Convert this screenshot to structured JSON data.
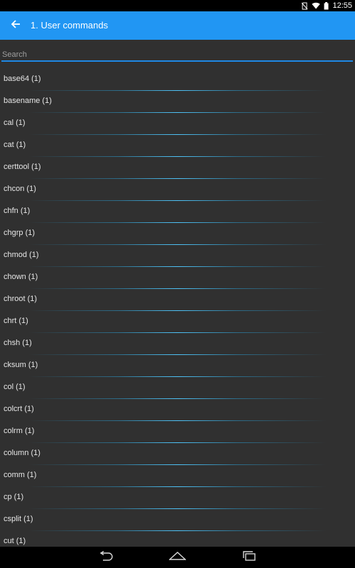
{
  "status_bar": {
    "time": "12:55",
    "icons": [
      "no-sim-icon",
      "wifi-icon",
      "battery-icon"
    ]
  },
  "app_bar": {
    "title": "1. User commands",
    "back_icon": "arrow-back-icon",
    "color": "#2196f3"
  },
  "search": {
    "placeholder": "Search",
    "value": ""
  },
  "commands": [
    {
      "label": "base64 (1)"
    },
    {
      "label": "basename (1)"
    },
    {
      "label": "cal (1)"
    },
    {
      "label": "cat (1)"
    },
    {
      "label": "certtool (1)"
    },
    {
      "label": "chcon (1)"
    },
    {
      "label": "chfn (1)"
    },
    {
      "label": "chgrp (1)"
    },
    {
      "label": "chmod (1)"
    },
    {
      "label": "chown (1)"
    },
    {
      "label": "chroot (1)"
    },
    {
      "label": "chrt (1)"
    },
    {
      "label": "chsh (1)"
    },
    {
      "label": "cksum (1)"
    },
    {
      "label": "col (1)"
    },
    {
      "label": "colcrt (1)"
    },
    {
      "label": "colrm (1)"
    },
    {
      "label": "column (1)"
    },
    {
      "label": "comm (1)"
    },
    {
      "label": "cp (1)"
    },
    {
      "label": "csplit (1)"
    },
    {
      "label": "cut (1)"
    }
  ],
  "nav_bar": {
    "buttons": [
      "back-icon",
      "home-icon",
      "recents-icon"
    ]
  },
  "colors": {
    "background": "#303030",
    "divider": "#29b6f6",
    "accent": "#1e88e5"
  }
}
